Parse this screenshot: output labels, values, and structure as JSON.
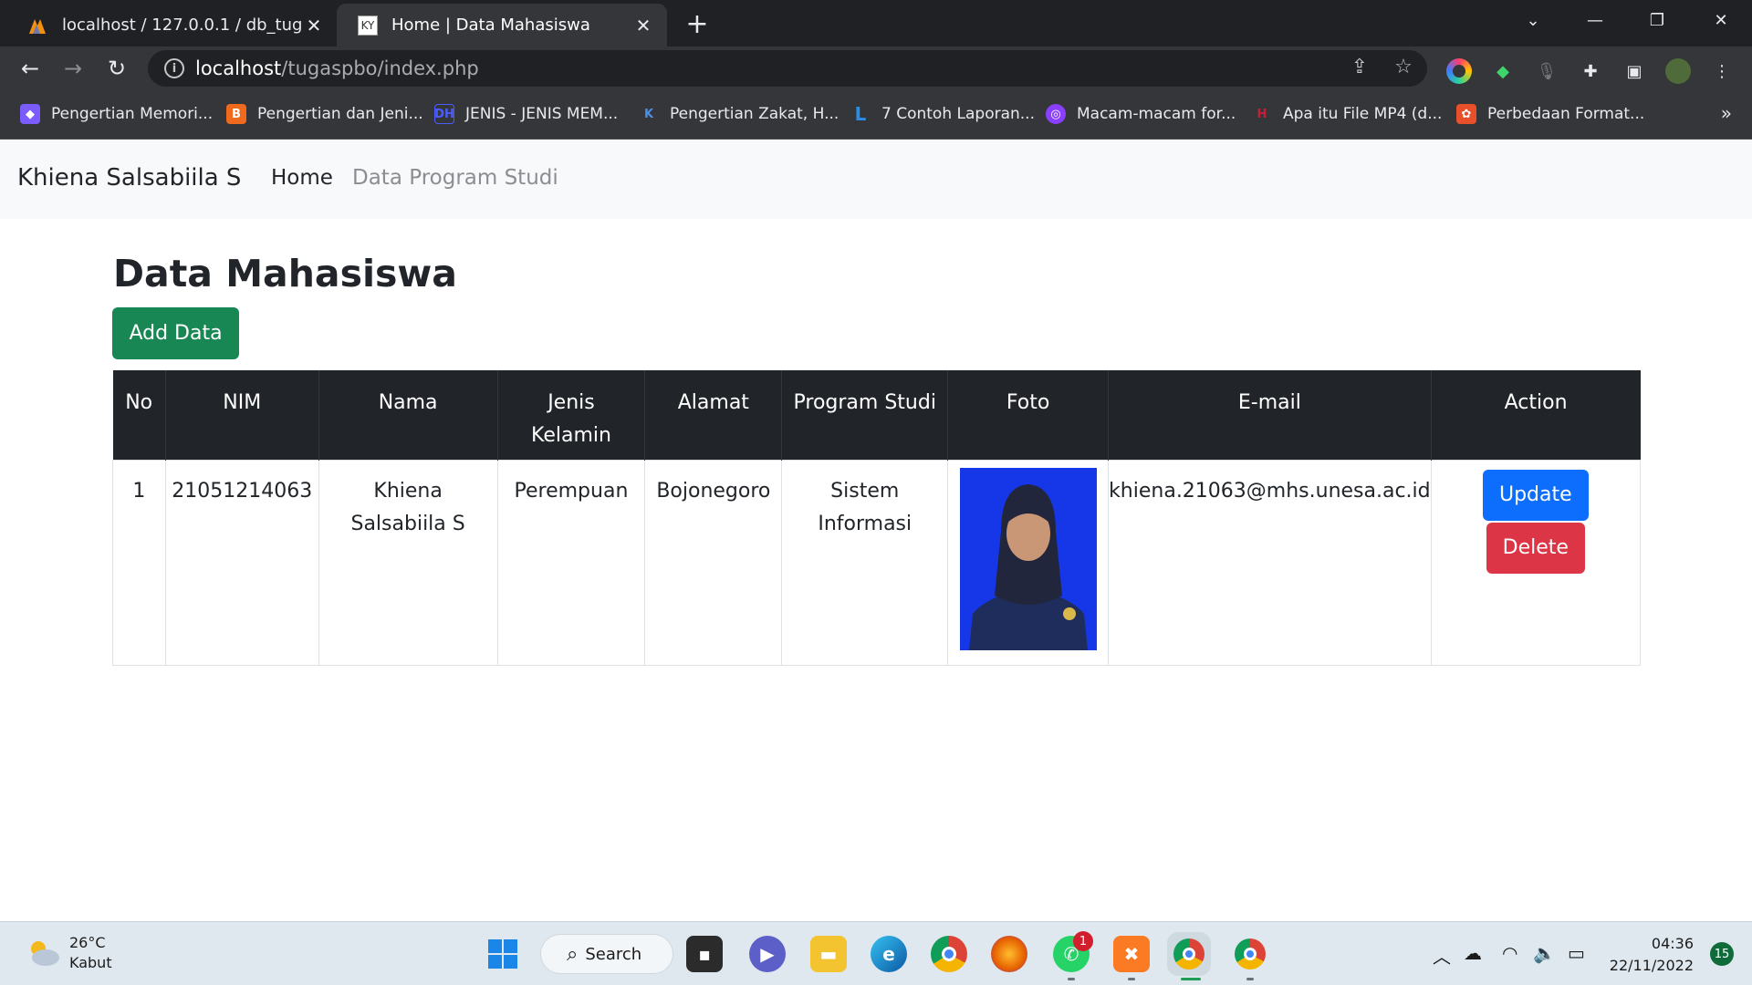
{
  "browser": {
    "tabs": [
      {
        "title": "localhost / 127.0.0.1 / db_tugaspbo",
        "active": false
      },
      {
        "title": "Home | Data Mahasiswa",
        "active": true
      }
    ],
    "url": {
      "host": "localhost",
      "path": "/tugaspbo/index.php"
    },
    "bookmarks": [
      {
        "label": "Pengertian Memori...",
        "icon": "purple-logo-icon",
        "color": "#7a5cff"
      },
      {
        "label": "Pengertian dan Jeni...",
        "icon": "blogger-icon",
        "color": "#f06a1d"
      },
      {
        "label": "JENIS - JENIS MEM...",
        "icon": "dh-logo-icon",
        "color": "#2b3fbf"
      },
      {
        "label": "Pengertian Zakat, H...",
        "icon": "k-logo-icon",
        "color": "#1f5fcf"
      },
      {
        "label": "7 Contoh Laporan...",
        "icon": "l-logo-icon",
        "color": "#2a7de1"
      },
      {
        "label": "Macam-macam for...",
        "icon": "circle-logo-icon",
        "color": "#8a3ffc"
      },
      {
        "label": "Apa itu File MP4 (d...",
        "icon": "h-logo-icon",
        "color": "#c0203a"
      },
      {
        "label": "Perbedaan Format...",
        "icon": "swirl-logo-icon",
        "color": "#e8502a"
      }
    ]
  },
  "navbar": {
    "brand": "Khiena Salsabiila S",
    "links": [
      "Home",
      "Data Program Studi"
    ]
  },
  "main": {
    "title": "Data Mahasiswa",
    "add_button": "Add Data",
    "table": {
      "headers": [
        "No",
        "NIM",
        "Nama",
        "Jenis Kelamin",
        "Alamat",
        "Program Studi",
        "Foto",
        "E-mail",
        "Action"
      ],
      "rows": [
        {
          "no": "1",
          "nim": "21051214063",
          "nama": "Khiena Salsabiila S",
          "jenis_kelamin": "Perempuan",
          "alamat": "Bojonegoro",
          "program_studi": "Sistem Informasi",
          "email": "khiena.21063@mhs.unesa.ac.id",
          "update_label": "Update",
          "delete_label": "Delete"
        }
      ]
    }
  },
  "taskbar": {
    "weather": {
      "temp": "26°C",
      "condition": "Kabut"
    },
    "search_label": "Search",
    "whatsapp_badge": "1",
    "clock": {
      "time": "04:36",
      "date": "22/11/2022"
    },
    "notifications": "15"
  },
  "colors": {
    "add_button": "#198754",
    "update_button": "#0d6efd",
    "delete_button": "#dc3545",
    "table_header": "#212529"
  }
}
